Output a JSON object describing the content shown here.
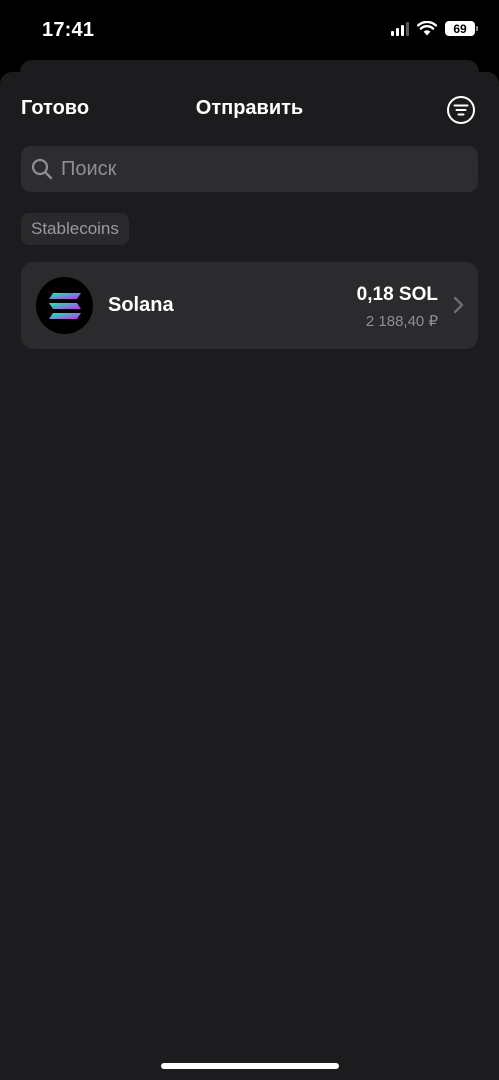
{
  "status_bar": {
    "time": "17:41",
    "battery": "69",
    "signal_icon": "cellular-signal-icon",
    "wifi_icon": "wifi-icon"
  },
  "nav": {
    "done_label": "Готово",
    "title": "Отправить",
    "filter_icon": "filter-icon"
  },
  "search": {
    "placeholder": "Поиск",
    "value": ""
  },
  "section_chip": "Stablecoins",
  "tokens": [
    {
      "name": "Solana",
      "amount": "0,18 SOL",
      "fiat": "2 188,40 ₽",
      "icon": "solana-logo-icon"
    }
  ],
  "colors": {
    "background": "#000000",
    "sheet": "#1c1c1e",
    "row": "#2b2b2d",
    "secondary_text": "#8e8e93"
  }
}
